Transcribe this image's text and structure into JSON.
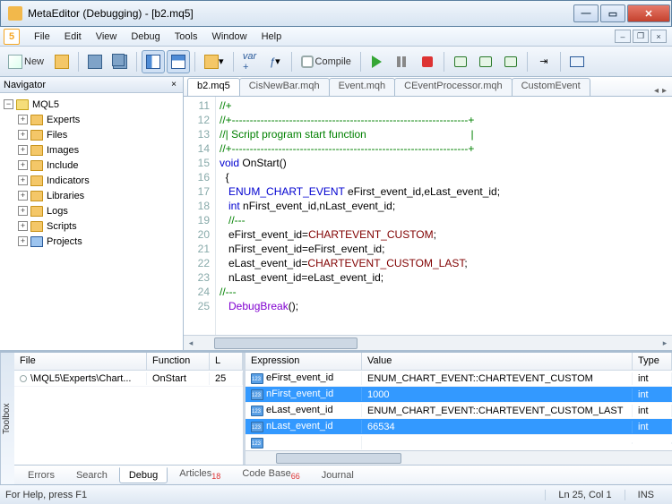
{
  "window": {
    "title": "MetaEditor (Debugging) - [b2.mq5]"
  },
  "menu": [
    "File",
    "Edit",
    "View",
    "Debug",
    "Tools",
    "Window",
    "Help"
  ],
  "toolbar": {
    "new": "New",
    "compile": "Compile"
  },
  "navigator": {
    "title": "Navigator",
    "root": "MQL5",
    "items": [
      "Experts",
      "Files",
      "Images",
      "Include",
      "Indicators",
      "Libraries",
      "Logs",
      "Scripts",
      "Projects"
    ]
  },
  "editor": {
    "tabs": [
      "b2.mq5",
      "CisNewBar.mqh",
      "Event.mqh",
      "CEventProcessor.mqh",
      "CustomEvent"
    ],
    "activeTab": 0,
    "code": [
      {
        "n": 11,
        "html": "<span class='cm'>//+</span>"
      },
      {
        "n": 12,
        "html": "<span class='cm'>//+------------------------------------------------------------------+</span>"
      },
      {
        "n": 13,
        "html": "<span class='cm'>//| Script program start function                                   |</span>"
      },
      {
        "n": 14,
        "html": "<span class='cm'>//+------------------------------------------------------------------+</span>"
      },
      {
        "n": 15,
        "html": "<span class='kw'>void</span> <span class='id'>OnStart</span>()"
      },
      {
        "n": 16,
        "html": "  {"
      },
      {
        "n": 17,
        "html": "   <span class='ty'>ENUM_CHART_EVENT</span> eFirst_event_id,eLast_event_id;"
      },
      {
        "n": 18,
        "html": "   <span class='kw'>int</span> nFirst_event_id,nLast_event_id;"
      },
      {
        "n": 19,
        "html": "   <span class='cm'>//---</span>"
      },
      {
        "n": 20,
        "html": "   eFirst_event_id=<span class='mc'>CHARTEVENT_CUSTOM</span>;",
        "bp": true
      },
      {
        "n": 21,
        "html": "   nFirst_event_id=eFirst_event_id;"
      },
      {
        "n": 22,
        "html": "   eLast_event_id=<span class='mc'>CHARTEVENT_CUSTOM_LAST</span>;"
      },
      {
        "n": 23,
        "html": "   nLast_event_id=eLast_event_id;"
      },
      {
        "n": 24,
        "html": "<span class='cm'>//---</span>"
      },
      {
        "n": 25,
        "html": "   <span class='pu'>DebugBreak</span>();",
        "cur": true
      }
    ]
  },
  "toolbox": {
    "label": "Toolbox",
    "stack": {
      "headers": [
        "File",
        "Function",
        "L"
      ],
      "rows": [
        {
          "file": "\\MQL5\\Experts\\Chart...",
          "func": "OnStart",
          "line": "25"
        }
      ]
    },
    "watch": {
      "headers": [
        "Expression",
        "Value",
        "Type"
      ],
      "rows": [
        {
          "expr": "eFirst_event_id",
          "val": "ENUM_CHART_EVENT::CHARTEVENT_CUSTOM",
          "type": "int",
          "sel": false
        },
        {
          "expr": "nFirst_event_id",
          "val": "1000",
          "type": "int",
          "sel": true
        },
        {
          "expr": "eLast_event_id",
          "val": "ENUM_CHART_EVENT::CHARTEVENT_CUSTOM_LAST",
          "type": "int",
          "sel": false
        },
        {
          "expr": "nLast_event_id",
          "val": "66534",
          "type": "int",
          "sel": true
        }
      ]
    },
    "tabs": [
      {
        "label": "Errors",
        "badge": ""
      },
      {
        "label": "Search",
        "badge": ""
      },
      {
        "label": "Debug",
        "badge": "",
        "active": true
      },
      {
        "label": "Articles",
        "badge": "18"
      },
      {
        "label": "Code Base",
        "badge": "66"
      },
      {
        "label": "Journal",
        "badge": ""
      }
    ]
  },
  "status": {
    "help": "For Help, press F1",
    "pos": "Ln 25, Col 1",
    "mode": "INS"
  }
}
